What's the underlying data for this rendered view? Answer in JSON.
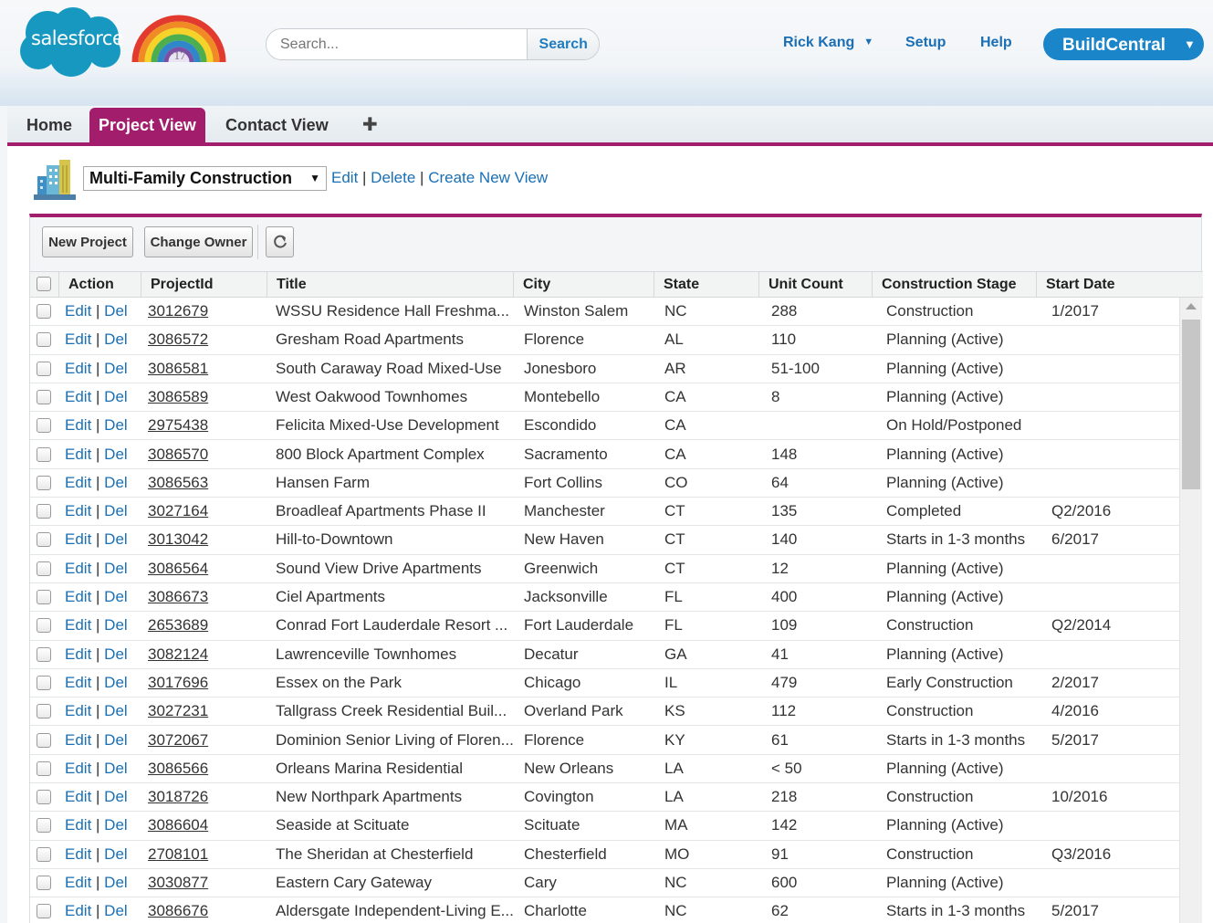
{
  "header": {
    "logo_text": "salesforce",
    "rainbow_badge": "'17",
    "search": {
      "placeholder": "Search...",
      "button_label": "Search"
    },
    "user_menu": "Rick Kang",
    "setup_label": "Setup",
    "help_label": "Help",
    "app_switcher": "BuildCentral"
  },
  "tabs": [
    {
      "label": "Home",
      "active": false
    },
    {
      "label": "Project View",
      "active": true
    },
    {
      "label": "Contact View",
      "active": false
    }
  ],
  "view": {
    "selected": "Multi-Family Construction",
    "edit": "Edit",
    "delete": "Delete",
    "create": "Create New View"
  },
  "toolbar": {
    "new_project": "New Project",
    "change_owner": "Change Owner"
  },
  "table": {
    "columns": [
      "Action",
      "ProjectId",
      "Title",
      "City",
      "State",
      "Unit Count",
      "Construction Stage",
      "Start Date"
    ],
    "action_edit": "Edit",
    "action_del": "Del",
    "rows": [
      {
        "id": "3012679",
        "title": "WSSU Residence Hall Freshma...",
        "city": "Winston Salem",
        "state": "NC",
        "units": "288",
        "stage": "Construction",
        "start": "1/2017"
      },
      {
        "id": "3086572",
        "title": "Gresham Road Apartments",
        "city": "Florence",
        "state": "AL",
        "units": "110",
        "stage": "Planning (Active)",
        "start": ""
      },
      {
        "id": "3086581",
        "title": "South Caraway Road Mixed-Use",
        "city": "Jonesboro",
        "state": "AR",
        "units": "51-100",
        "stage": "Planning (Active)",
        "start": ""
      },
      {
        "id": "3086589",
        "title": "West Oakwood Townhomes",
        "city": "Montebello",
        "state": "CA",
        "units": "8",
        "stage": "Planning (Active)",
        "start": ""
      },
      {
        "id": "2975438",
        "title": "Felicita Mixed-Use Development",
        "city": "Escondido",
        "state": "CA",
        "units": "",
        "stage": "On Hold/Postponed",
        "start": ""
      },
      {
        "id": "3086570",
        "title": "800 Block Apartment Complex",
        "city": "Sacramento",
        "state": "CA",
        "units": "148",
        "stage": "Planning (Active)",
        "start": ""
      },
      {
        "id": "3086563",
        "title": "Hansen Farm",
        "city": "Fort Collins",
        "state": "CO",
        "units": "64",
        "stage": "Planning (Active)",
        "start": ""
      },
      {
        "id": "3027164",
        "title": "Broadleaf Apartments Phase II",
        "city": "Manchester",
        "state": "CT",
        "units": "135",
        "stage": "Completed",
        "start": "Q2/2016"
      },
      {
        "id": "3013042",
        "title": "Hill-to-Downtown",
        "city": "New Haven",
        "state": "CT",
        "units": "140",
        "stage": "Starts in 1-3 months",
        "start": "6/2017"
      },
      {
        "id": "3086564",
        "title": "Sound View Drive Apartments",
        "city": "Greenwich",
        "state": "CT",
        "units": "12",
        "stage": "Planning (Active)",
        "start": ""
      },
      {
        "id": "3086673",
        "title": "Ciel Apartments",
        "city": "Jacksonville",
        "state": "FL",
        "units": "400",
        "stage": "Planning (Active)",
        "start": ""
      },
      {
        "id": "2653689",
        "title": "Conrad Fort Lauderdale Resort ...",
        "city": "Fort Lauderdale",
        "state": "FL",
        "units": "109",
        "stage": "Construction",
        "start": "Q2/2014"
      },
      {
        "id": "3082124",
        "title": "Lawrenceville Townhomes",
        "city": "Decatur",
        "state": "GA",
        "units": "41",
        "stage": "Planning (Active)",
        "start": ""
      },
      {
        "id": "3017696",
        "title": "Essex on the Park",
        "city": "Chicago",
        "state": "IL",
        "units": "479",
        "stage": "Early Construction",
        "start": "2/2017"
      },
      {
        "id": "3027231",
        "title": "Tallgrass Creek Residential Buil...",
        "city": "Overland Park",
        "state": "KS",
        "units": "112",
        "stage": "Construction",
        "start": "4/2016"
      },
      {
        "id": "3072067",
        "title": "Dominion Senior Living of Floren...",
        "city": "Florence",
        "state": "KY",
        "units": "61",
        "stage": "Starts in 1-3 months",
        "start": "5/2017"
      },
      {
        "id": "3086566",
        "title": "Orleans Marina Residential",
        "city": "New Orleans",
        "state": "LA",
        "units": "< 50",
        "stage": "Planning (Active)",
        "start": ""
      },
      {
        "id": "3018726",
        "title": "New Northpark Apartments",
        "city": "Covington",
        "state": "LA",
        "units": "218",
        "stage": "Construction",
        "start": "10/2016"
      },
      {
        "id": "3086604",
        "title": "Seaside at Scituate",
        "city": "Scituate",
        "state": "MA",
        "units": "142",
        "stage": "Planning (Active)",
        "start": ""
      },
      {
        "id": "2708101",
        "title": "The Sheridan at Chesterfield",
        "city": "Chesterfield",
        "state": "MO",
        "units": "91",
        "stage": "Construction",
        "start": "Q3/2016"
      },
      {
        "id": "3030877",
        "title": "Eastern Cary Gateway",
        "city": "Cary",
        "state": "NC",
        "units": "600",
        "stage": "Planning (Active)",
        "start": ""
      },
      {
        "id": "3086676",
        "title": "Aldersgate Independent-Living E...",
        "city": "Charlotte",
        "state": "NC",
        "units": "62",
        "stage": "Starts in 1-3 months",
        "start": "5/2017"
      }
    ]
  }
}
